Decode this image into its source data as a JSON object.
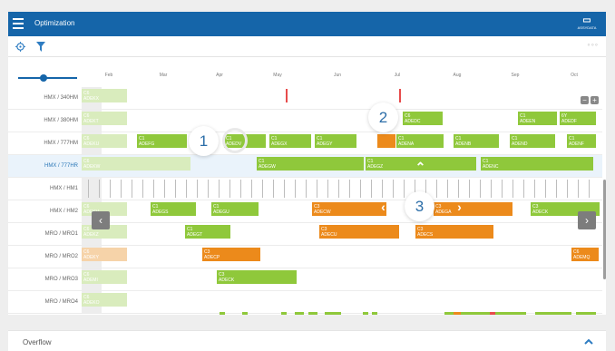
{
  "header": {
    "title": "Optimization",
    "logo_text": "ASSYDATA"
  },
  "toolbar": {
    "more_label": "◦◦◦"
  },
  "timeline": {
    "months": [
      "Feb",
      "Mar",
      "Apr",
      "May",
      "Jun",
      "Jul",
      "Aug",
      "Sep",
      "Oct"
    ]
  },
  "rows": [
    {
      "label": "HMX / 340HM",
      "highlighted": false
    },
    {
      "label": "HMX / 380HM",
      "highlighted": false
    },
    {
      "label": "HMX / 777HM",
      "highlighted": false
    },
    {
      "label": "HMX / 777HR",
      "highlighted": true
    },
    {
      "label": "HMX / HM1",
      "highlighted": false
    },
    {
      "label": "HMX / HM2",
      "highlighted": false
    },
    {
      "label": "MRO / MRO1",
      "highlighted": false
    },
    {
      "label": "MRO / MRO2",
      "highlighted": false
    },
    {
      "label": "MRO / MRO3",
      "highlighted": false
    },
    {
      "label": "MRO / MRO4",
      "highlighted": false
    }
  ],
  "bars": [
    {
      "row": 0,
      "line1": "C6",
      "line2": "ADEKX",
      "color": "pale"
    },
    {
      "row": 1,
      "line1": "C6",
      "line2": "ADEKT",
      "color": "pale"
    },
    {
      "row": 1,
      "line1": "C6",
      "line2": "ADEDC",
      "color": "green"
    },
    {
      "row": 1,
      "line1": "C1",
      "line2": "ADEEN",
      "color": "green"
    },
    {
      "row": 1,
      "line1": "6Y",
      "line2": "ADEDF",
      "color": "green"
    },
    {
      "row": 2,
      "line1": "C6",
      "line2": "ADEKU",
      "color": "pale"
    },
    {
      "row": 2,
      "line1": "C1",
      "line2": "ADEFG",
      "color": "green"
    },
    {
      "row": 2,
      "line1": "C1",
      "line2": "ADEDV",
      "color": "green"
    },
    {
      "row": 2,
      "line1": "C1",
      "line2": "ADEGX",
      "color": "green"
    },
    {
      "row": 2,
      "line1": "C1",
      "line2": "ADEGY",
      "color": "green"
    },
    {
      "row": 2,
      "line1": "",
      "line2": "",
      "color": "orange"
    },
    {
      "row": 2,
      "line1": "C1",
      "line2": "ADENA",
      "color": "green"
    },
    {
      "row": 2,
      "line1": "C1",
      "line2": "ADENB",
      "color": "green"
    },
    {
      "row": 2,
      "line1": "C1",
      "line2": "ADEND",
      "color": "green"
    },
    {
      "row": 2,
      "line1": "C1",
      "line2": "ADENF",
      "color": "green"
    },
    {
      "row": 3,
      "line1": "C6",
      "line2": "ADEKW",
      "color": "pale"
    },
    {
      "row": 3,
      "line1": "C1",
      "line2": "ADEGW",
      "color": "green"
    },
    {
      "row": 3,
      "line1": "C1",
      "line2": "ADEGZ",
      "color": "green"
    },
    {
      "row": 3,
      "line1": "C1",
      "line2": "ADENC",
      "color": "green"
    },
    {
      "row": 5,
      "line1": "C6",
      "line2": "ADEKV",
      "color": "pale"
    },
    {
      "row": 5,
      "line1": "C1",
      "line2": "ADEGS",
      "color": "green"
    },
    {
      "row": 5,
      "line1": "C1",
      "line2": "ADEGU",
      "color": "green"
    },
    {
      "row": 5,
      "line1": "C3",
      "line2": "ADECW",
      "color": "orange"
    },
    {
      "row": 5,
      "line1": "C3",
      "line2": "ADEGA",
      "color": "orange"
    },
    {
      "row": 5,
      "line1": "C3",
      "line2": "ADECK",
      "color": "green"
    },
    {
      "row": 6,
      "line1": "C6",
      "line2": "ADEKZ",
      "color": "pale"
    },
    {
      "row": 6,
      "line1": "C1",
      "line2": "ADEGT",
      "color": "green"
    },
    {
      "row": 6,
      "line1": "C3",
      "line2": "ADECU",
      "color": "orange"
    },
    {
      "row": 6,
      "line1": "C3",
      "line2": "ADECS",
      "color": "orange"
    },
    {
      "row": 7,
      "line1": "C6",
      "line2": "ADEKY",
      "color": "pale-orange"
    },
    {
      "row": 7,
      "line1": "C3",
      "line2": "ADECP",
      "color": "orange"
    },
    {
      "row": 7,
      "line1": "C6",
      "line2": "ADEMQ",
      "color": "orange"
    },
    {
      "row": 8,
      "line1": "C6",
      "line2": "ADEMI",
      "color": "pale"
    },
    {
      "row": 8,
      "line1": "C3",
      "line2": "ADECK",
      "color": "green"
    },
    {
      "row": 9,
      "line1": "C6",
      "line2": "ADEKO",
      "color": "pale"
    }
  ],
  "callouts": [
    "1",
    "2",
    "3"
  ],
  "overflow": {
    "title": "Overflow"
  },
  "colors": {
    "header": "#1565a9",
    "green": "#8fc83b",
    "orange": "#ec8a1b",
    "pale_green": "#d9ecbd",
    "red_marker": "#e74b4b"
  },
  "icons": {
    "menu": "hamburger-menu-icon",
    "target": "target-icon",
    "filter": "filter-icon",
    "more": "more-dots-icon",
    "left": "chevron-left-icon",
    "right": "chevron-right-icon",
    "collapse": "chevron-up-icon"
  }
}
